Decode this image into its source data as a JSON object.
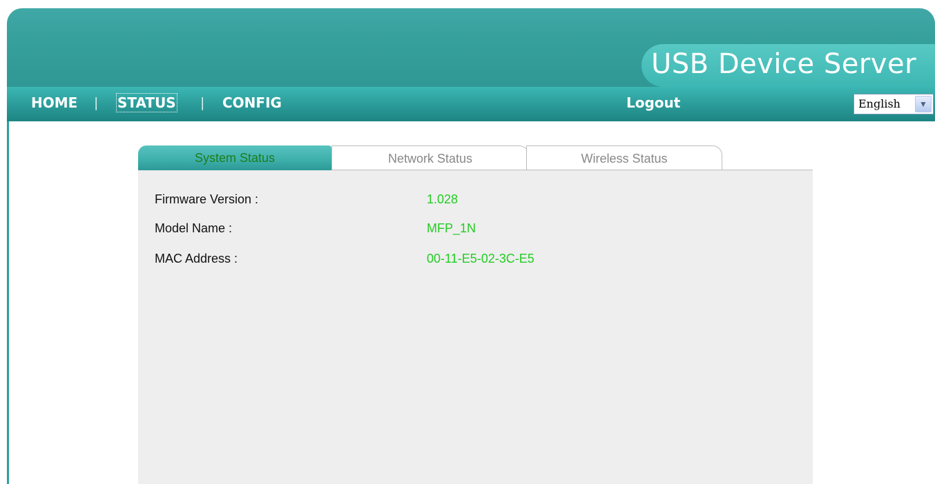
{
  "header": {
    "title": "USB Device Server"
  },
  "nav": {
    "items": [
      {
        "label": "HOME"
      },
      {
        "label": "STATUS"
      },
      {
        "label": "CONFIG"
      }
    ],
    "separator": "|",
    "logout_label": "Logout",
    "language": {
      "selected": "English",
      "arrow_icon": "chevron-down-icon"
    }
  },
  "tabs": [
    {
      "label": "System Status",
      "active": true
    },
    {
      "label": "Network Status",
      "active": false
    },
    {
      "label": "Wireless Status",
      "active": false
    }
  ],
  "system_status": {
    "rows": [
      {
        "label": "Firmware Version :",
        "value": "1.028"
      },
      {
        "label": "Model Name :",
        "value": "MFP_1N"
      },
      {
        "label": "MAC Address :",
        "value": "00-11-E5-02-3C-E5"
      }
    ]
  },
  "colors": {
    "header": "#36a09d",
    "brand_pill": "#4cc0bc",
    "value_text": "#22cc22",
    "active_tab_text": "#1e7d1e"
  }
}
